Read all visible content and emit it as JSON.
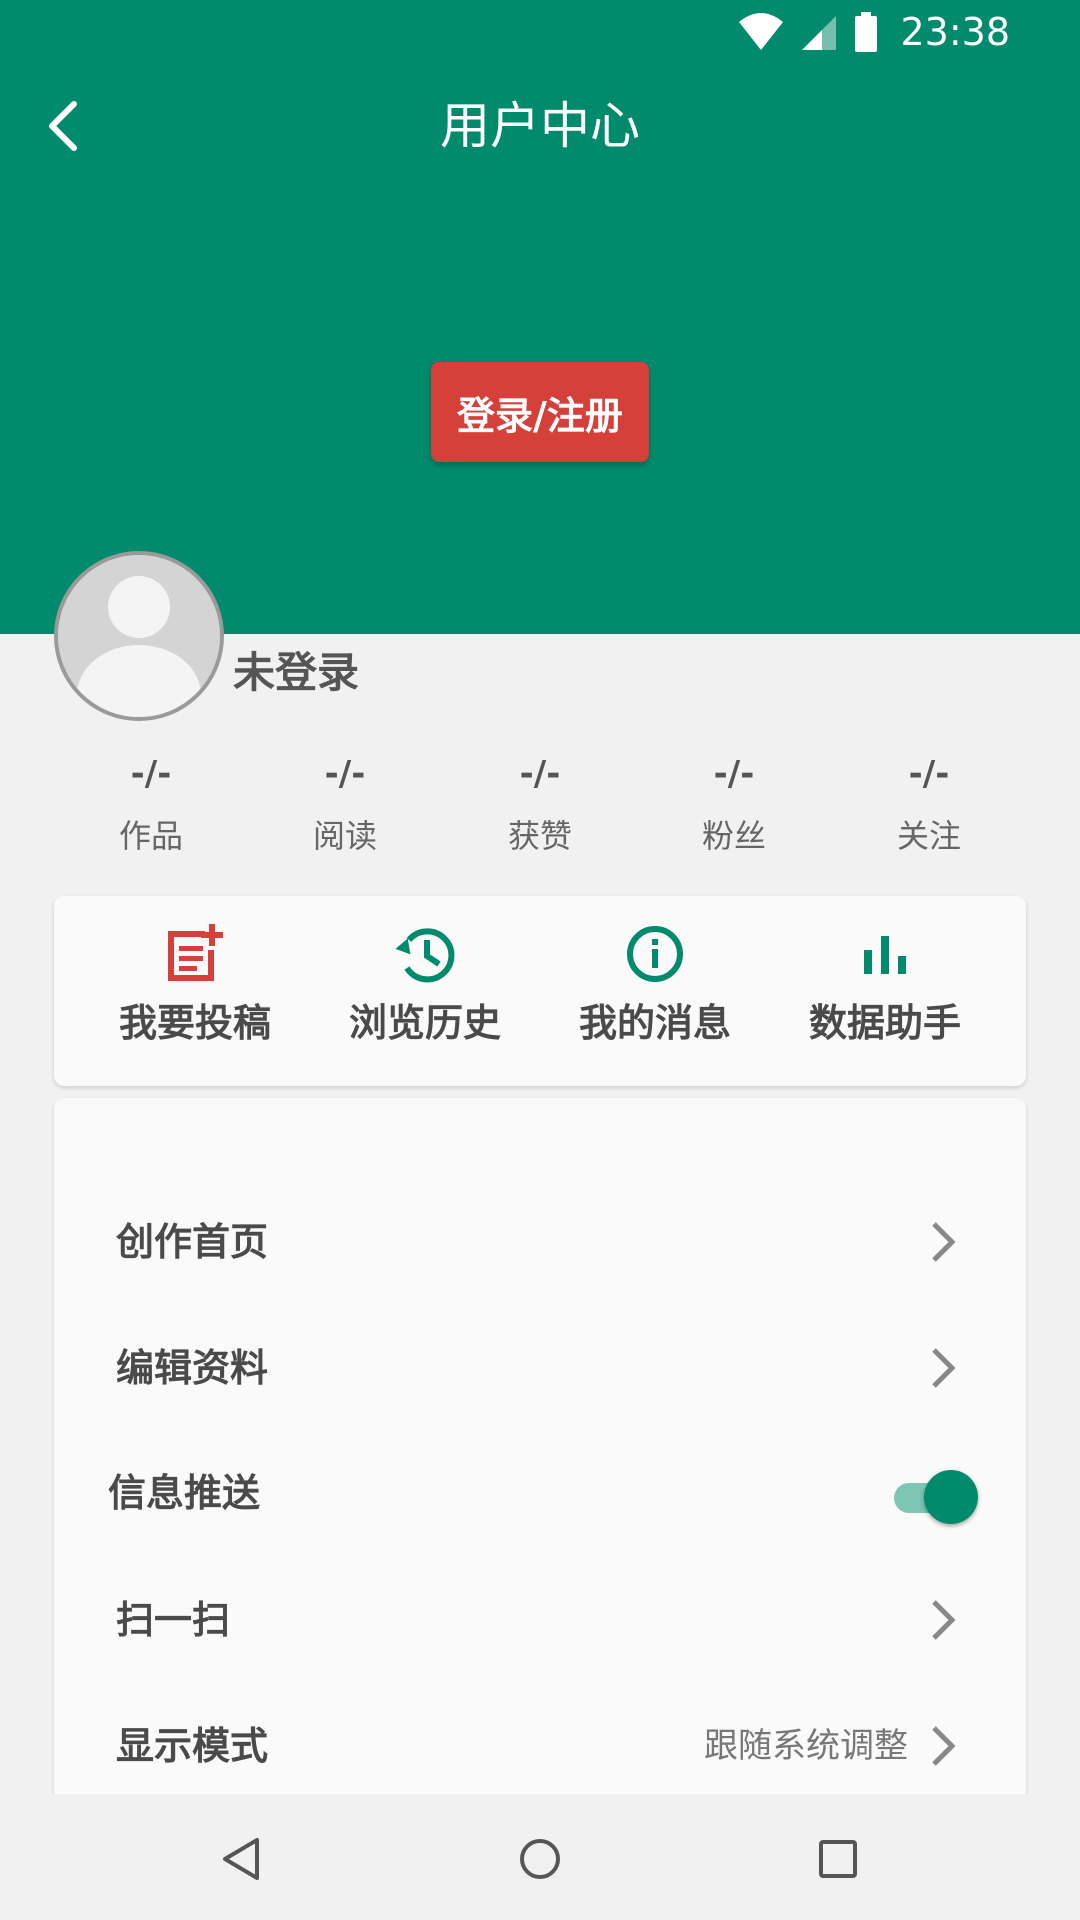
{
  "status_bar": {
    "time": "23:38",
    "icons": [
      "wifi-icon",
      "cellular-signal-icon",
      "battery-icon"
    ]
  },
  "toolbar": {
    "back_icon": "back-arrow-icon",
    "title": "用户中心"
  },
  "header": {
    "login_button": "登录/注册",
    "color": "#028a6c"
  },
  "profile": {
    "avatar_icon": "default-avatar-icon",
    "username": "未登录"
  },
  "stats": [
    {
      "value": "-/-",
      "label": "作品"
    },
    {
      "value": "-/-",
      "label": "阅读"
    },
    {
      "value": "-/-",
      "label": "获赞"
    },
    {
      "value": "-/-",
      "label": "粉丝"
    },
    {
      "value": "-/-",
      "label": "关注"
    }
  ],
  "quick_actions": [
    {
      "label": "我要投稿",
      "icon": "post-add-icon",
      "color": "#d6403b"
    },
    {
      "label": "浏览历史",
      "icon": "history-icon",
      "color": "#028a6c"
    },
    {
      "label": "我的消息",
      "icon": "info-icon",
      "color": "#028a6c"
    },
    {
      "label": "数据助手",
      "icon": "bar-chart-icon",
      "color": "#028a6c"
    }
  ],
  "menu": {
    "create_home": "创作首页",
    "edit_profile": "编辑资料",
    "push": {
      "label": "信息推送",
      "enabled": true
    },
    "scan": "扫一扫",
    "display_mode": {
      "label": "显示模式",
      "value": "跟随系统调整"
    }
  },
  "nav_bar": {
    "icons": [
      "nav-back-icon",
      "nav-home-icon",
      "nav-recents-icon"
    ]
  }
}
